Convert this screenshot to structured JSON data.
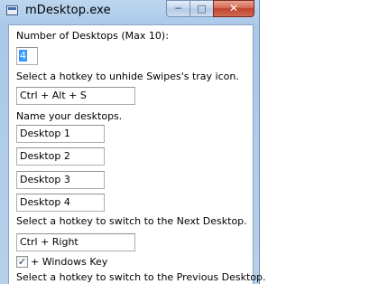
{
  "window": {
    "title": "mDesktop.exe",
    "min_label": "─",
    "max_label": "□",
    "close_label": "✕"
  },
  "form": {
    "num_desktops_label": "Number of Desktops (Max 10):",
    "num_desktops_value": "4",
    "unhide_label": "Select a hotkey to unhide Swipes's tray icon.",
    "unhide_hotkey": "Ctrl + Alt + S",
    "names_label": "Name your desktops.",
    "desktop_names": [
      "Desktop 1",
      "Desktop 2",
      "Desktop 3",
      "Desktop 4"
    ],
    "next_label": "Select a hotkey to switch to the Next Desktop.",
    "next_hotkey": "Ctrl + Right",
    "windows_key_label": "+ Windows Key",
    "windows_key_checked": true,
    "windows_key_mark": "✓",
    "prev_label": "Select a hotkey to switch to the Previous Desktop."
  }
}
